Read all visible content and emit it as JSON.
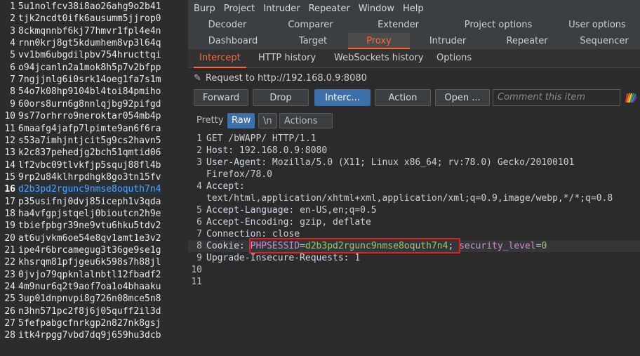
{
  "left_list": [
    {
      "n": "1",
      "t": "5u1nolfcv38i8ao26ahg9o2b41"
    },
    {
      "n": "2",
      "t": "tjk2ncdt0ifk6ausumm5jjrop0"
    },
    {
      "n": "3",
      "t": "8ckmqnnbf6kj77hmvr1fpl4e4n"
    },
    {
      "n": "4",
      "t": "rnn0krj8gt5kdumhem8vp3l64q"
    },
    {
      "n": "5",
      "t": "vv1bm6ubgdilpbv754hructtqi"
    },
    {
      "n": "6",
      "t": "o94jcanln2a1mok8h5p7v2bfpp"
    },
    {
      "n": "7",
      "t": "7ngjjnlg6i0srk14oeg1fa7s1m"
    },
    {
      "n": "8",
      "t": "54o7k08hp9104bl4toi84pmiho"
    },
    {
      "n": "9",
      "t": "60ors8urn6g8nnlqjbg92pifgd"
    },
    {
      "n": "10",
      "t": "9s77orhrro9neroktar054mb4p"
    },
    {
      "n": "11",
      "t": "6maafg4jafp7lpimte9an6f6ra"
    },
    {
      "n": "12",
      "t": "s53a7imhjntjcit5g9cs2havn5"
    },
    {
      "n": "13",
      "t": "k2c837pehedjg2bch51qmtid06"
    },
    {
      "n": "14",
      "t": "lf2vbc09tlvkfjp5squj88fl4b"
    },
    {
      "n": "15",
      "t": "9rp2u84klhrpdhgk8go3tn15fv"
    },
    {
      "n": "16",
      "t": "d2b3pd2rgunc9nmse8oquth7n4"
    },
    {
      "n": "17",
      "t": "p35usifnj0dvj85iceph1v3qda"
    },
    {
      "n": "18",
      "t": "ha4vfgpjstqelj0bioutcn2h9e"
    },
    {
      "n": "19",
      "t": "tbiefpbgr39ne9vtu6hku5tdv2"
    },
    {
      "n": "20",
      "t": "at6ujvkm6oe54e8qv1amt1e3v2"
    },
    {
      "n": "21",
      "t": "ipe4r6brcamegug3t36ge9se1g"
    },
    {
      "n": "22",
      "t": "khsrqm81pfjgeu6k598s7h88jl"
    },
    {
      "n": "23",
      "t": "0jvjo79qpknlalnbtl12fbadf2"
    },
    {
      "n": "24",
      "t": "4m9nur6q2t9aof7oa1o4bhaaku"
    },
    {
      "n": "25",
      "t": "3up01dnpnvpi8g726n08mce5n8"
    },
    {
      "n": "26",
      "t": "n3hn571pc2f8j6j05quff2il3d"
    },
    {
      "n": "27",
      "t": "5fefpabgcfnrkgp2n827nk8gsj"
    },
    {
      "n": "28",
      "t": "itk4rpgg7vbd7dq9j659hu3dcb"
    }
  ],
  "menu": [
    "Burp",
    "Project",
    "Intruder",
    "Repeater",
    "Window",
    "Help"
  ],
  "tabs_row1": [
    "Decoder",
    "Comparer",
    "Extender",
    "Project options",
    "User options"
  ],
  "tabs_row2": [
    "Dashboard",
    "Target",
    "Proxy",
    "Intruder",
    "Repeater",
    "Sequencer"
  ],
  "subtabs": [
    "Intercept",
    "HTTP history",
    "WebSockets history",
    "Options"
  ],
  "request_label": "Request to http://192.168.0.9:8080",
  "buttons": {
    "forward": "Forward",
    "drop": "Drop",
    "intercept": "Interc...",
    "action": "Action",
    "open": "Open ..."
  },
  "comment_placeholder": "Comment this item",
  "editor_buttons": {
    "pretty": "Pretty",
    "raw": "Raw",
    "newline": "\\n",
    "actions": "Actions"
  },
  "request_lines": {
    "l1": "GET /bWAPP/ HTTP/1.1",
    "l2h": "Host: ",
    "l2v": "192.168.0.9:8080",
    "l3h": "User-Agent: ",
    "l3v": "Mozilla/5.0 (X11; Linux x86_64; rv:78.0) Gecko/20100101",
    "l3b": "Firefox/78.0",
    "l4h": "Accept:",
    "l4b": "text/html,application/xhtml+xml,application/xml;q=0.9,image/webp,*/*;q=0.8",
    "l5h": "Accept-Language: ",
    "l5v": "en-US,en;q=0.5",
    "l6h": "Accept-Encoding: ",
    "l6v": "gzip, deflate",
    "l7h": "Connection: ",
    "l7v": "close",
    "l8h": "Cookie: ",
    "l8k1": "PHPSESSID",
    "l8v1": "d2b3pd2rgunc9nmse8oquth7n4",
    "l8sep": "; ",
    "l8k2": "security_level",
    "l8v2": "0",
    "l9h": "Upgrade-Insecure-Requests: ",
    "l9v": "1"
  },
  "line_numbers": [
    "1",
    "2",
    "3",
    "4",
    "5",
    "6",
    "7",
    "8",
    "9",
    "10",
    "11"
  ],
  "colors": {
    "accent": "#ff6633",
    "primary": "#3d6fa8",
    "highlight_box": "#e02020"
  }
}
